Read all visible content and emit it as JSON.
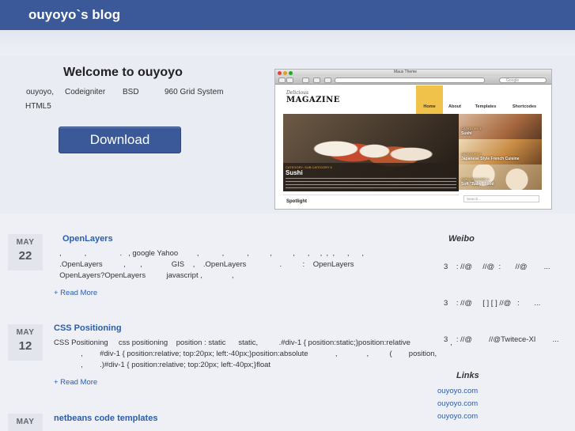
{
  "header": {
    "site_title": "ouyoyo`s blog"
  },
  "hero": {
    "title": "Welcome to ouyoyo",
    "tags": [
      "ouyoyo,",
      "Codeigniter",
      "BSD",
      "960 Grid System",
      "HTML5"
    ],
    "download_label": "Download",
    "preview": {
      "window_title": "Maus Theme",
      "search_placeholder": "Google",
      "logo_small": "Delicious",
      "logo": "MAGAZINE",
      "nav": [
        "Home",
        "About",
        "Templates",
        "Shortcodes"
      ],
      "featured_category": "CATEGORY: SUB CATEGORY 5",
      "featured_title": "Sushi",
      "thumbs": [
        {
          "category": "CATEGORY 3",
          "title": "Sushi"
        },
        {
          "category": "CATEGORY 2",
          "title": "Japanese Style French Cuisine"
        },
        {
          "category": "SUB CATEGORY 2",
          "title": "Soft \"Baby\" Food"
        }
      ],
      "spotlight": "Spotlight",
      "search_label": "Search..."
    }
  },
  "posts": [
    {
      "month": "MAY",
      "day": "22",
      "title": "OpenLayers",
      "lines": [
        ",           ,                .   , google Yahoo         ,           ,           ,          ,          ,      ,     ,  ,  ,      ,      ,",
        "  .OpenLayers          ,       ,              GIS    ,    .OpenLayers                .          :    OpenLayers",
        "  OpenLayers?OpenLayers          javascript ,              ,"
      ],
      "read_more": "+ Read More"
    },
    {
      "month": "MAY",
      "day": "12",
      "title": "CSS Positioning",
      "lines": [
        "CSS Positioning     css positioning    position : static      static,          .#div-1 { position:static;}position:relative                   ,",
        "             ,        #div-1 { position:relative; top:20px; left:-40px;}position:absolute             ,              ,          (        position,",
        "             ,        .)#div-1 { position:relative; top:20px; left:-40px;}float"
      ],
      "read_more": "+ Read More"
    },
    {
      "month": "MAY",
      "day": "",
      "title": "netbeans code templates",
      "lines": [],
      "read_more": ""
    }
  ],
  "sidebar": {
    "weibo_title": "Weibo",
    "weibo_items": [
      "3    : //@     //@  :       //@        ...",
      "3    : //@     [ ] [ ] //@   :       ...",
      "3    : //@        //@Twitece-XI        ..."
    ],
    "links_title": "Links",
    "links": [
      "ouyoyo.com",
      "ouyoyo.com",
      "ouyoyo.com"
    ]
  }
}
